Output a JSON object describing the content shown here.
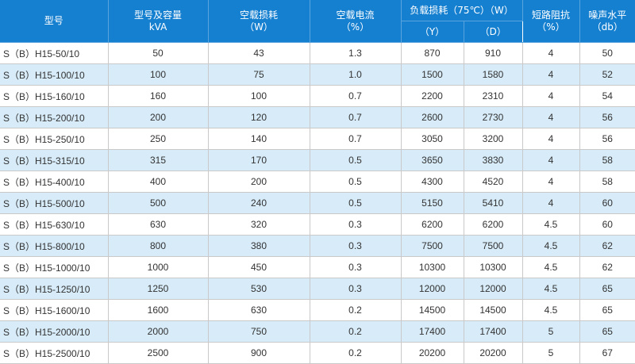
{
  "headers": {
    "model": "型号",
    "capacity_line1": "型号及容量",
    "capacity_line2": "kVA",
    "noload_loss_line1": "空载损耗",
    "noload_loss_line2": "（W）",
    "noload_current_line1": "空载电流",
    "noload_current_line2": "（%）",
    "load_loss": "负载损耗（75℃）（W）",
    "load_loss_y": "（Y）",
    "load_loss_d": "（D）",
    "impedance_line1": "短路阻抗",
    "impedance_line2": "（%）",
    "noise_line1": "噪声水平",
    "noise_line2": "（db）"
  },
  "rows": [
    {
      "model": "S（B）H15-50/10",
      "capacity": "50",
      "noload_loss": "43",
      "noload_current": "1.3",
      "load_y": "870",
      "load_d": "910",
      "impedance": "4",
      "noise": "50"
    },
    {
      "model": "S（B）H15-100/10",
      "capacity": "100",
      "noload_loss": "75",
      "noload_current": "1.0",
      "load_y": "1500",
      "load_d": "1580",
      "impedance": "4",
      "noise": "52"
    },
    {
      "model": "S（B）H15-160/10",
      "capacity": "160",
      "noload_loss": "100",
      "noload_current": "0.7",
      "load_y": "2200",
      "load_d": "2310",
      "impedance": "4",
      "noise": "54"
    },
    {
      "model": "S（B）H15-200/10",
      "capacity": "200",
      "noload_loss": "120",
      "noload_current": "0.7",
      "load_y": "2600",
      "load_d": "2730",
      "impedance": "4",
      "noise": "56"
    },
    {
      "model": "S（B）H15-250/10",
      "capacity": "250",
      "noload_loss": "140",
      "noload_current": "0.7",
      "load_y": "3050",
      "load_d": "3200",
      "impedance": "4",
      "noise": "56"
    },
    {
      "model": "S（B）H15-315/10",
      "capacity": "315",
      "noload_loss": "170",
      "noload_current": "0.5",
      "load_y": "3650",
      "load_d": "3830",
      "impedance": "4",
      "noise": "58"
    },
    {
      "model": "S（B）H15-400/10",
      "capacity": "400",
      "noload_loss": "200",
      "noload_current": "0.5",
      "load_y": "4300",
      "load_d": "4520",
      "impedance": "4",
      "noise": "58"
    },
    {
      "model": "S（B）H15-500/10",
      "capacity": "500",
      "noload_loss": "240",
      "noload_current": "0.5",
      "load_y": "5150",
      "load_d": "5410",
      "impedance": "4",
      "noise": "60"
    },
    {
      "model": "S（B）H15-630/10",
      "capacity": "630",
      "noload_loss": "320",
      "noload_current": "0.3",
      "load_y": "6200",
      "load_d": "6200",
      "impedance": "4.5",
      "noise": "60"
    },
    {
      "model": "S（B）H15-800/10",
      "capacity": "800",
      "noload_loss": "380",
      "noload_current": "0.3",
      "load_y": "7500",
      "load_d": "7500",
      "impedance": "4.5",
      "noise": "62"
    },
    {
      "model": "S（B）H15-1000/10",
      "capacity": "1000",
      "noload_loss": "450",
      "noload_current": "0.3",
      "load_y": "10300",
      "load_d": "10300",
      "impedance": "4.5",
      "noise": "62"
    },
    {
      "model": "S（B）H15-1250/10",
      "capacity": "1250",
      "noload_loss": "530",
      "noload_current": "0.3",
      "load_y": "12000",
      "load_d": "12000",
      "impedance": "4.5",
      "noise": "65"
    },
    {
      "model": "S（B）H15-1600/10",
      "capacity": "1600",
      "noload_loss": "630",
      "noload_current": "0.2",
      "load_y": "14500",
      "load_d": "14500",
      "impedance": "4.5",
      "noise": "65"
    },
    {
      "model": "S（B）H15-2000/10",
      "capacity": "2000",
      "noload_loss": "750",
      "noload_current": "0.2",
      "load_y": "17400",
      "load_d": "17400",
      "impedance": "5",
      "noise": "65"
    },
    {
      "model": "S（B）H15-2500/10",
      "capacity": "2500",
      "noload_loss": "900",
      "noload_current": "0.2",
      "load_y": "20200",
      "load_d": "20200",
      "impedance": "5",
      "noise": "67"
    }
  ],
  "colors": {
    "header_bg": "#157fd0",
    "header_text": "#ffffff",
    "row_alt_bg": "#d7ebf8",
    "grid": "#c9c9c9"
  }
}
